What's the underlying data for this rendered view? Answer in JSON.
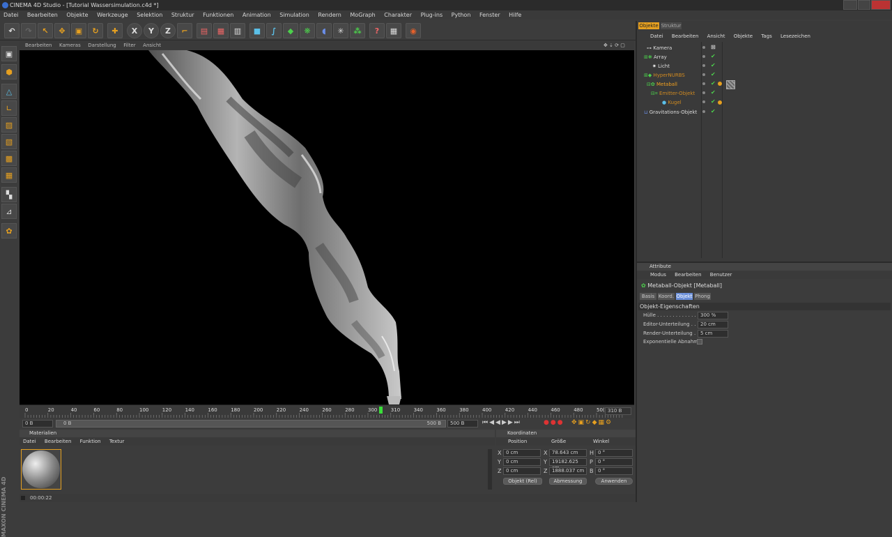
{
  "app": {
    "title": "CINEMA 4D Studio - [Tutorial Wassersimulation.c4d *]"
  },
  "menu": [
    "Datei",
    "Bearbeiten",
    "Objekte",
    "Werkzeuge",
    "Selektion",
    "Struktur",
    "Funktionen",
    "Animation",
    "Simulation",
    "Rendern",
    "MoGraph",
    "Charakter",
    "Plug-ins",
    "Python",
    "Fenster",
    "Hilfe"
  ],
  "viewport_menu": [
    "Bearbeiten",
    "Kameras",
    "Darstellung",
    "Filter",
    "Ansicht"
  ],
  "timeline": {
    "ticks": [
      "0",
      "20",
      "40",
      "60",
      "80",
      "100",
      "120",
      "140",
      "160",
      "180",
      "200",
      "220",
      "240",
      "260",
      "280",
      "300",
      "310",
      "340",
      "360",
      "380",
      "400",
      "420",
      "440",
      "460",
      "480",
      "50("
    ],
    "current_frame": "310 B",
    "start": "0 B",
    "range_start": "0 B",
    "range_end": "500 B",
    "end": "500 B",
    "playhead_frame": 310
  },
  "materials": {
    "title": "Materialien",
    "menu": [
      "Datei",
      "Bearbeiten",
      "Funktion",
      "Textur"
    ]
  },
  "coords": {
    "title": "Koordinaten",
    "headers": [
      "Position",
      "Größe",
      "Winkel"
    ],
    "rows": [
      {
        "axis": "X",
        "pos": "0 cm",
        "size_axis": "X",
        "size": "78.643 cm",
        "rot_axis": "H",
        "rot": "0 °"
      },
      {
        "axis": "Y",
        "pos": "0 cm",
        "size_axis": "Y",
        "size": "19182.625 cm",
        "rot_axis": "P",
        "rot": "0 °"
      },
      {
        "axis": "Z",
        "pos": "0 cm",
        "size_axis": "Z",
        "size": "1888.037 cm",
        "rot_axis": "B",
        "rot": "0 °"
      }
    ],
    "mode": "Objekt (Rel)",
    "size_mode": "Abmessung",
    "apply": "Anwenden"
  },
  "status": {
    "time": "00:00:22"
  },
  "brand": "MAXON CINEMA 4D",
  "objects_panel": {
    "tabs": [
      "Objekte",
      "Struktur"
    ],
    "menu": [
      "Datei",
      "Bearbeiten",
      "Ansicht",
      "Objekte",
      "Tags",
      "Lesezeichen"
    ],
    "items": [
      {
        "name": "Kamera",
        "color": "#dddddd"
      },
      {
        "name": "Array",
        "color": "#dddddd"
      },
      {
        "name": "Licht",
        "color": "#dddddd"
      },
      {
        "name": "HyperNURBS",
        "color": "#d08a20"
      },
      {
        "name": "Metaball",
        "color": "#f0a020"
      },
      {
        "name": "Emitter-Objekt",
        "color": "#d08a20"
      },
      {
        "name": "Kugel",
        "color": "#d08a20"
      },
      {
        "name": "Gravitations-Objekt",
        "color": "#dddddd"
      }
    ]
  },
  "attributes": {
    "title": "Attribute",
    "menu": [
      "Modus",
      "Bearbeiten",
      "Benutzer"
    ],
    "object_label": "Metaball-Objekt [Metaball]",
    "tabs": [
      "Basis",
      "Koord.",
      "Objekt",
      "Phong"
    ],
    "active_tab": "Objekt",
    "section": "Objekt-Eigenschaften",
    "props": [
      {
        "label": "Hülle . . . . . . . . . . . . . . .",
        "value": "300 %"
      },
      {
        "label": "Editor-Unterteilung . . . .",
        "value": "20 cm"
      },
      {
        "label": "Render-Unterteilung . . .",
        "value": "5 cm"
      },
      {
        "label": "Exponentielle Abnahme",
        "value": ""
      }
    ]
  }
}
